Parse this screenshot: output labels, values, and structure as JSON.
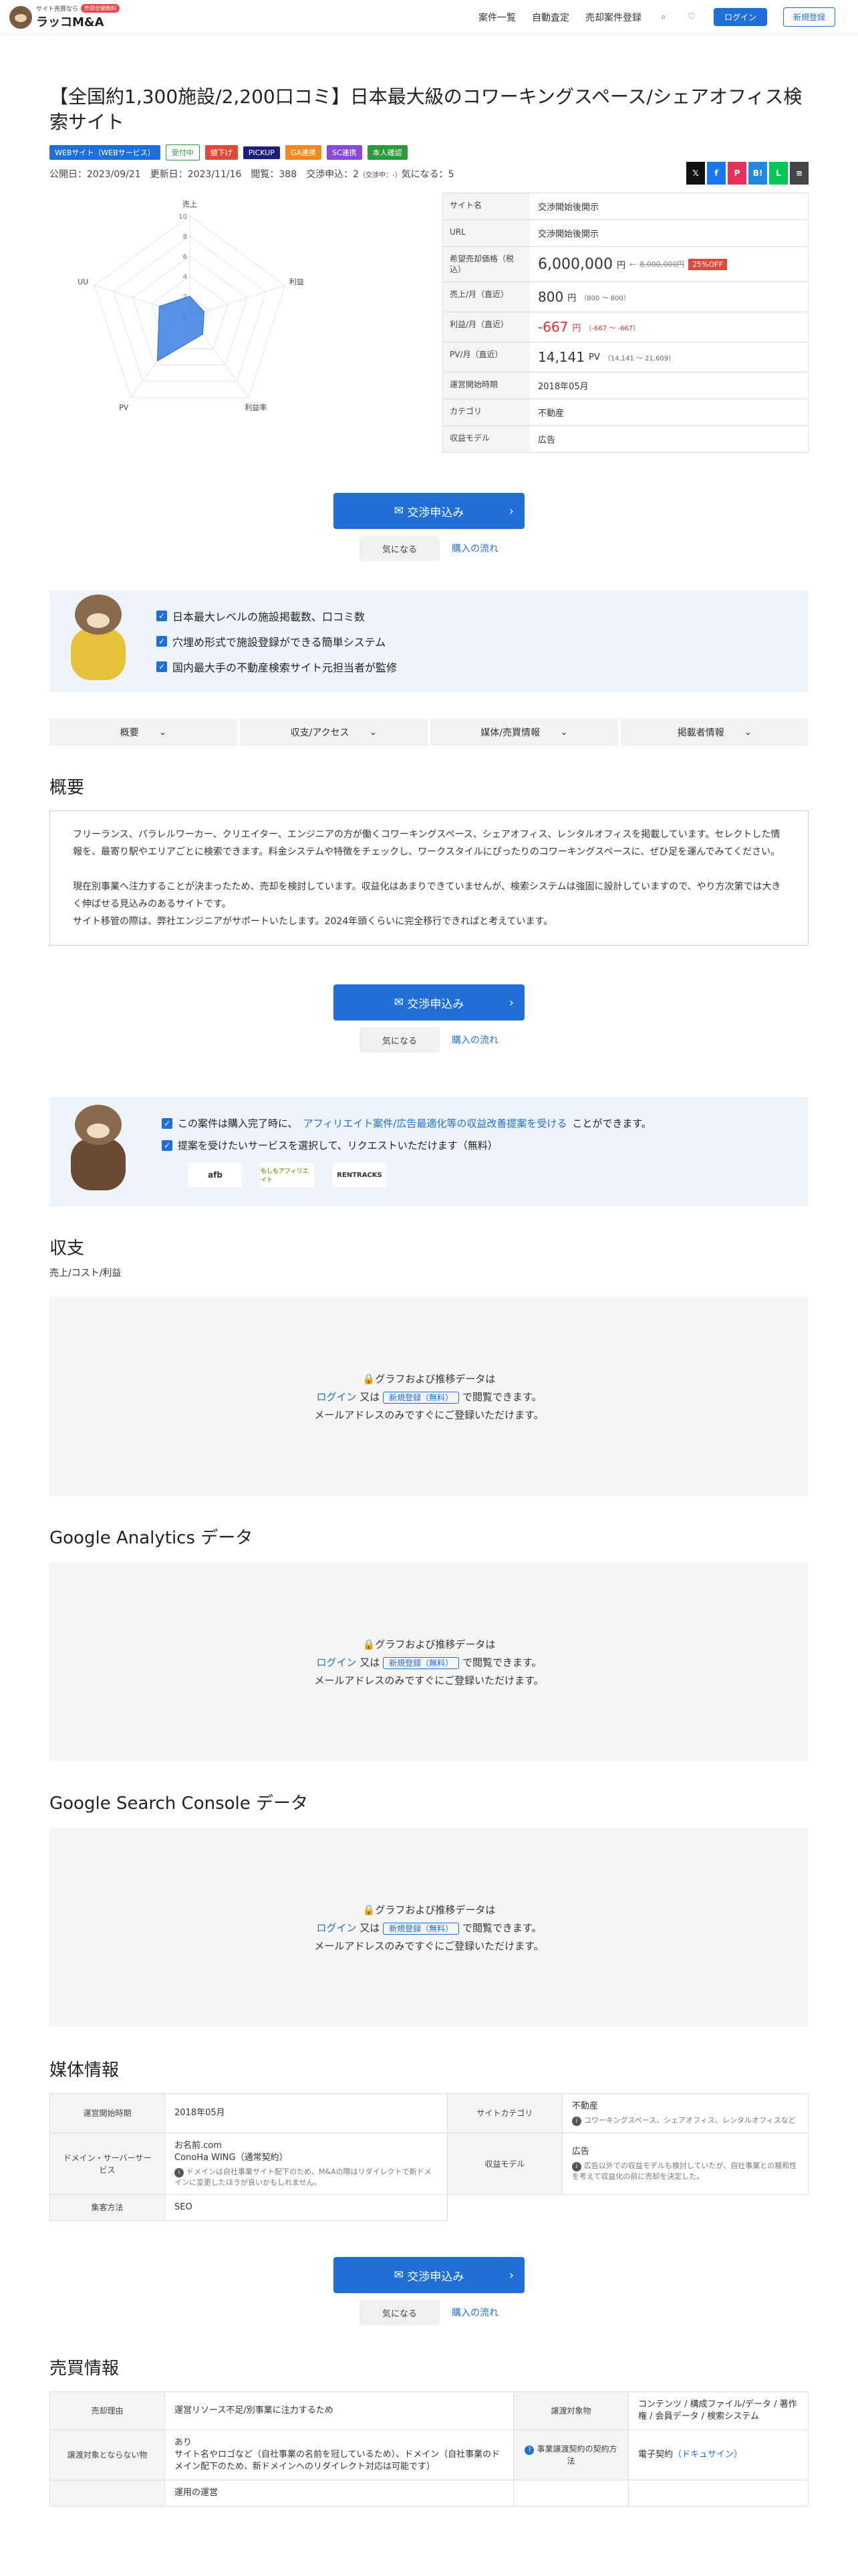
{
  "header": {
    "logo_tagline": "サイト売買なら",
    "logo_badge": "売却全額無料",
    "logo_name": "ラッコM&A",
    "nav": [
      "案件一覧",
      "自動査定",
      "売却案件登録"
    ],
    "login": "ログイン",
    "register": "新規登録"
  },
  "listing": {
    "title": "【全国約1,300施設/2,200口コミ】日本最大級のコワーキングスペース/シェアオフィス検索サイト",
    "tags": [
      {
        "label": "WEBサイト（WEBサービス）",
        "color": "#1f6fd6"
      },
      {
        "label": "受付中",
        "color": "#2e9a3c"
      },
      {
        "label": "値下げ",
        "color": "#e04a3a"
      },
      {
        "label": "PICKUP",
        "color": "#1d1d7a"
      },
      {
        "label": "GA連携",
        "color": "#f08a1c"
      },
      {
        "label": "SC連携",
        "color": "#8a4ad6"
      },
      {
        "label": "本人確認",
        "color": "#2e9a3c"
      }
    ],
    "meta": "公開日：2023/09/21　更新日：2023/11/16　閲覧：388　交渉申込：2",
    "meta_small": "（交渉中：-）",
    "meta_fav": "気になる：5",
    "shares": [
      "𝕏",
      "f",
      "P",
      "B!",
      "L",
      "≡"
    ]
  },
  "radar": {
    "axes": [
      "売上",
      "利益",
      "利益率",
      "PV",
      "UU"
    ],
    "ticks": [
      "10",
      "8",
      "6",
      "4",
      "2",
      "0"
    ],
    "values": [
      2,
      1.5,
      2.2,
      5.5,
      3.2
    ]
  },
  "info": [
    {
      "key": "サイト名",
      "value": "交渉開始後開示"
    },
    {
      "key": "URL",
      "value": "交渉開始後開示"
    },
    {
      "key": "希望売却価格（税込）",
      "price": "6,000,000",
      "unit": "円",
      "old": "8,000,000円",
      "off": "25%OFF"
    },
    {
      "key": "売上/月（直近）",
      "value": "800",
      "unit": "円",
      "range": "（800 〜 800）"
    },
    {
      "key": "利益/月（直近）",
      "value": "-667",
      "unit": "円",
      "range": "（-667 〜 -667）"
    },
    {
      "key": "PV/月（直近）",
      "value": "14,141",
      "unit": "PV",
      "range": "（14,141 〜 21,609）"
    },
    {
      "key": "運営開始時期",
      "value": "2018年05月"
    },
    {
      "key": "カテゴリ",
      "value": "不動産"
    },
    {
      "key": "収益モデル",
      "value": "広告"
    }
  ],
  "cta": {
    "apply": "交渉申込み",
    "fav": "気になる",
    "flow": "購入の流れ"
  },
  "features": [
    "日本最大レベルの施設掲載数、口コミ数",
    "穴埋め形式で施設登録ができる簡単システム",
    "国内最大手の不動産検索サイト元担当者が監修"
  ],
  "tabs": [
    "概要",
    "収支/アクセス",
    "媒体/売買情報",
    "掲載者情報"
  ],
  "overview": {
    "heading": "概要",
    "p1": "フリーランス、パラレルワーカー、クリエイター、エンジニアの方が働くコワーキングスペース、シェアオフィス、レンタルオフィスを掲載しています。セレクトした情報を、最寄り駅やエリアごとに検索できます。料金システムや特徴をチェックし、ワークスタイルにぴったりのコワーキングスペースに、ぜひ足を運んでみてください。",
    "p2": "現在別事業へ注力することが決まったため、売却を検討しています。収益化はあまりできていませんが、検索システムは強固に設計していますので、やり方次第では大きく伸ばせる見込みのあるサイトです。",
    "p3": "サイト移管の際は、弊社エンジニアがサポートいたします。2024年頭くらいに完全移行できればと考えています。"
  },
  "improve": {
    "line1_pre": "この案件は購入完了時に、",
    "line1_link": "アフィリエイト案件/広告最適化等の収益改善提案を受ける",
    "line1_post": "ことができます。",
    "line2": "提案を受けたいサービスを選択して、リクエストいただけます（無料）",
    "logos": [
      "afb",
      "もしもアフィリエイト",
      "RENTRACKS"
    ]
  },
  "revenue": {
    "heading": "収支",
    "sub": "売上/コスト/利益"
  },
  "lock": {
    "title": "グラフおよび推移データは",
    "login": "ログイン",
    "or": "又は",
    "reg": "新規登録（無料）",
    "after": "で閲覧できます。",
    "line3": "メールアドレスのみですぐにご登録いただけます。"
  },
  "ga": {
    "heading": "Google Analytics データ"
  },
  "sc": {
    "heading": "Google Search Console データ"
  },
  "media": {
    "heading": "媒体情報",
    "start_k": "運営開始時期",
    "start_v": "2018年05月",
    "cat_k": "サイトカテゴリ",
    "cat_v": "不動産",
    "cat_note": "コワーキングスペース、シェアオフィス、レンタルオフィスなど",
    "domain_k": "ドメイン・サーバーサービス",
    "domain_v1": "お名前.com",
    "domain_v2": "ConoHa WING（通常契約）",
    "domain_note": "ドメインは自社事業サイト配下のため、M&Aの際はリダイレクトで新ドメインに変更したほうが良いかもしれません。",
    "rev_k": "収益モデル",
    "rev_v": "広告",
    "rev_note": "広告以外での収益モデルも検討していたが、自社事業との親和性を考えて収益化の前に売却を決定した。",
    "traffic_k": "集客方法",
    "traffic_v": "SEO"
  },
  "sale": {
    "heading": "売買情報",
    "reason_k": "売却理由",
    "reason_v": "運営リソース不足/別事業に注力するため",
    "target_k": "譲渡対象物",
    "target_v": "コンテンツ / 構成ファイル/データ / 著作権 / 会員データ / 検索システム",
    "excl_k": "譲渡対象とならない物",
    "excl_v1": "あり",
    "excl_v2": "サイト名やロゴなど（自社事業の名前を冠しているため）、ドメイン（自社事業のドメイン配下のため、新ドメインへのリダイレクト対応は可能です）",
    "contract_k": "事業譲渡契約の契約方法",
    "contract_v": "電子契約",
    "contract_link": "（ドキュサイン）",
    "cut_v": "運用の運営"
  }
}
